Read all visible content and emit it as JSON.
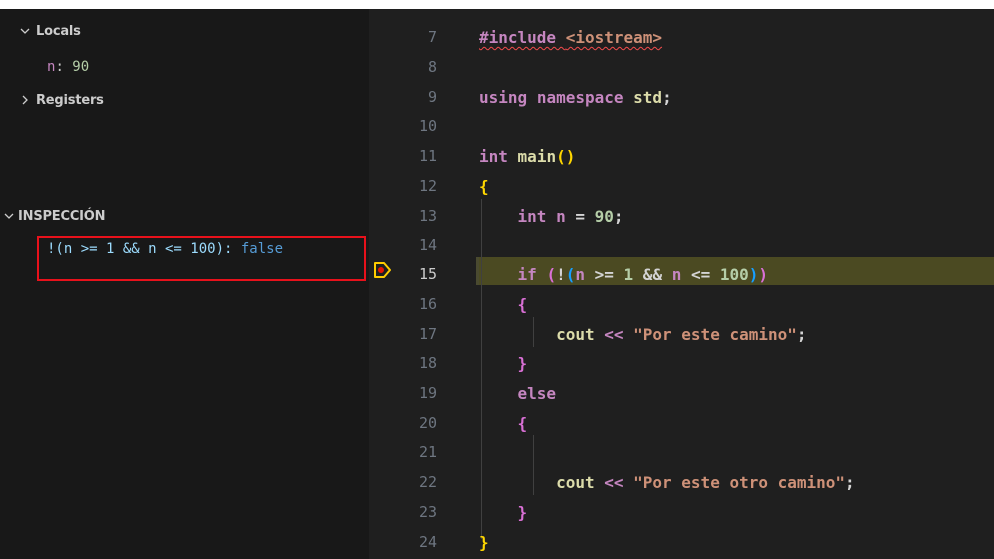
{
  "debug": {
    "locals_title": "Locals",
    "locals": [
      {
        "name": "n",
        "sep": ": ",
        "value": "90"
      }
    ],
    "registers_title": "Registers",
    "watch_title": "INSPECCIÓN",
    "watch": [
      {
        "expr": "!(n >= 1 && n <= 100)",
        "sep": ": ",
        "value": "false"
      }
    ]
  },
  "editor": {
    "current_line": "15",
    "line_numbers": [
      "7",
      "8",
      "9",
      "10",
      "11",
      "12",
      "13",
      "14",
      "15",
      "16",
      "17",
      "18",
      "19",
      "20",
      "21",
      "22",
      "23",
      "24"
    ],
    "lines": {
      "l7_directive": "#include",
      "l7_file": "<iostream>",
      "l9_using": "using",
      "l9_namespace": "namespace",
      "l9_std": "std",
      "l9_semi": ";",
      "l11_int": "int",
      "l11_main": "main",
      "l11_paren_open": "(",
      "l11_paren_close": ")",
      "l12_brace": "{",
      "l13_int": "int",
      "l13_n": "n",
      "l13_eq": " = ",
      "l13_val": "90",
      "l13_semi": ";",
      "l15_if": "if",
      "l15_p1": "(",
      "l15_not": "!",
      "l15_p2": "(",
      "l15_n1": "n",
      "l15_ge": " >= ",
      "l15_one": "1",
      "l15_and": " && ",
      "l15_n2": "n",
      "l15_le": " <= ",
      "l15_hundred": "100",
      "l15_p3": ")",
      "l15_p4": ")",
      "l16_brace": "{",
      "l17_cout": "cout",
      "l17_op": " << ",
      "l17_str": "\"Por este camino\"",
      "l17_semi": ";",
      "l18_brace": "}",
      "l19_else": "else",
      "l20_brace": "{",
      "l22_cout": "cout",
      "l22_op": " << ",
      "l22_str": "\"Por este otro camino\"",
      "l22_semi": ";",
      "l23_brace": "}",
      "l24_brace": "}"
    }
  }
}
